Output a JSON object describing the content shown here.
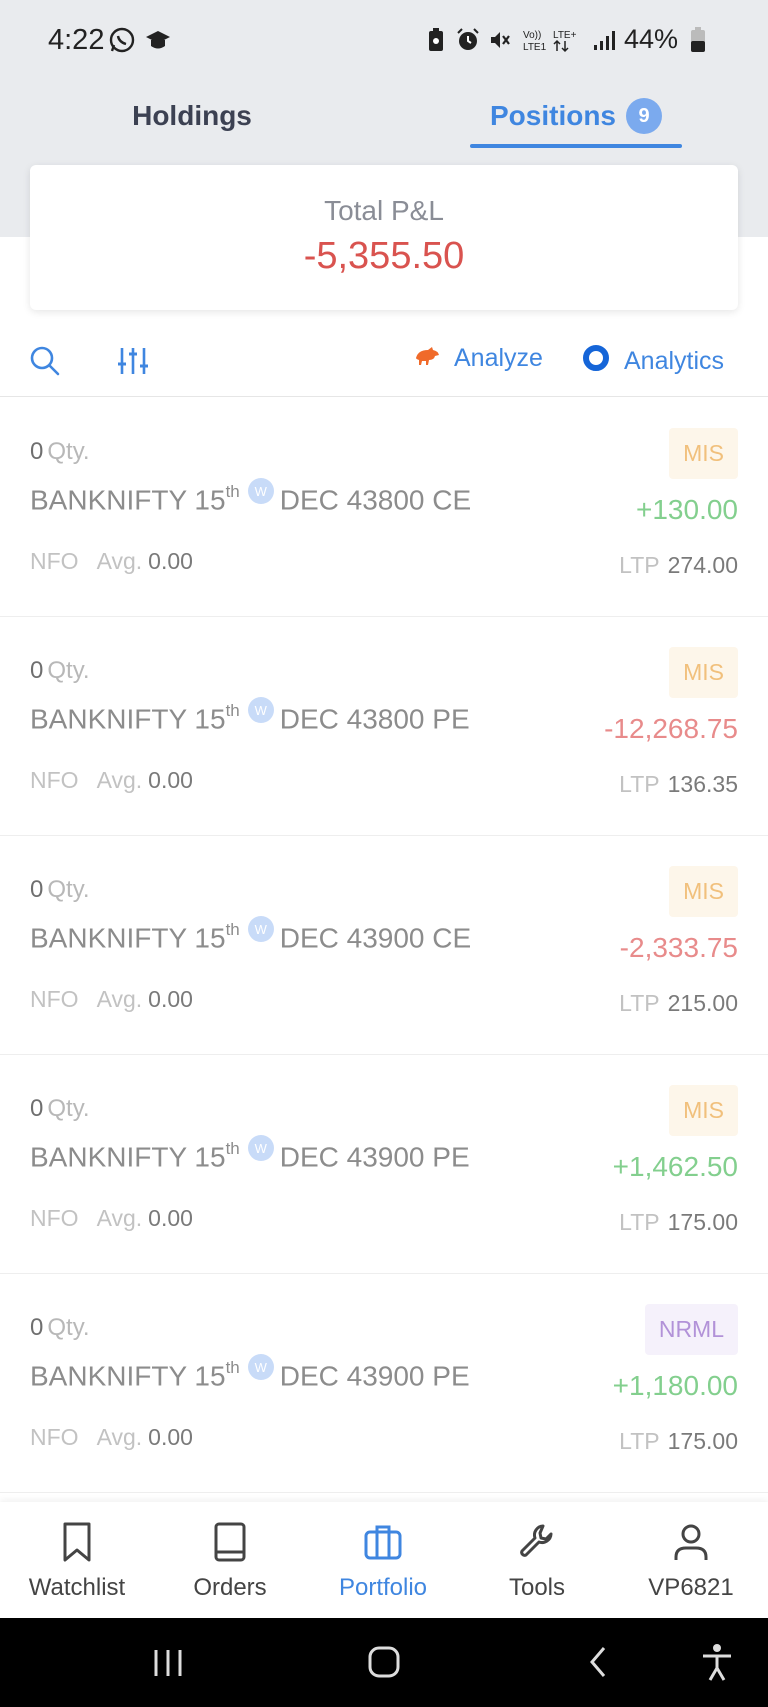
{
  "status_bar": {
    "time": "4:22",
    "left_icons": [
      "whatsapp-icon",
      "graduation-cap-icon"
    ],
    "right_icons": [
      "battery-saver-icon",
      "alarm-icon",
      "mute-icon",
      "volte-lte-icon",
      "signal-icon"
    ],
    "battery": "44%"
  },
  "tabs": {
    "holdings": "Holdings",
    "positions": "Positions",
    "positions_count": "9",
    "active": "positions"
  },
  "summary": {
    "label": "Total P&L",
    "value": "-5,355.50"
  },
  "toolbar": {
    "analyze_label": "Analyze",
    "analytics_label": "Analytics"
  },
  "positions": [
    {
      "qty": "0",
      "qty_label": "Qty.",
      "symbol_main": "BANKNIFTY 15",
      "symbol_sup": "th",
      "weekly_badge": "W",
      "symbol_rest": "DEC 43800 CE",
      "exchange": "NFO",
      "avg_label": "Avg.",
      "avg": "0.00",
      "product": "MIS",
      "pnl": "+130.00",
      "pnl_sign": "pos",
      "ltp_label": "LTP",
      "ltp": "274.00"
    },
    {
      "qty": "0",
      "qty_label": "Qty.",
      "symbol_main": "BANKNIFTY 15",
      "symbol_sup": "th",
      "weekly_badge": "W",
      "symbol_rest": "DEC 43800 PE",
      "exchange": "NFO",
      "avg_label": "Avg.",
      "avg": "0.00",
      "product": "MIS",
      "pnl": "-12,268.75",
      "pnl_sign": "neg",
      "ltp_label": "LTP",
      "ltp": "136.35"
    },
    {
      "qty": "0",
      "qty_label": "Qty.",
      "symbol_main": "BANKNIFTY 15",
      "symbol_sup": "th",
      "weekly_badge": "W",
      "symbol_rest": "DEC 43900 CE",
      "exchange": "NFO",
      "avg_label": "Avg.",
      "avg": "0.00",
      "product": "MIS",
      "pnl": "-2,333.75",
      "pnl_sign": "neg",
      "ltp_label": "LTP",
      "ltp": "215.00"
    },
    {
      "qty": "0",
      "qty_label": "Qty.",
      "symbol_main": "BANKNIFTY 15",
      "symbol_sup": "th",
      "weekly_badge": "W",
      "symbol_rest": "DEC 43900 PE",
      "exchange": "NFO",
      "avg_label": "Avg.",
      "avg": "0.00",
      "product": "MIS",
      "pnl": "+1,462.50",
      "pnl_sign": "pos",
      "ltp_label": "LTP",
      "ltp": "175.00"
    },
    {
      "qty": "0",
      "qty_label": "Qty.",
      "symbol_main": "BANKNIFTY 15",
      "symbol_sup": "th",
      "weekly_badge": "W",
      "symbol_rest": "DEC 43900 PE",
      "exchange": "NFO",
      "avg_label": "Avg.",
      "avg": "0.00",
      "product": "NRML",
      "pnl": "+1,180.00",
      "pnl_sign": "pos",
      "ltp_label": "LTP",
      "ltp": "175.00"
    }
  ],
  "bottom_nav": [
    {
      "label": "Watchlist",
      "icon": "bookmark-icon"
    },
    {
      "label": "Orders",
      "icon": "book-icon"
    },
    {
      "label": "Portfolio",
      "icon": "briefcase-icon",
      "active": true
    },
    {
      "label": "Tools",
      "icon": "wrench-icon"
    },
    {
      "label": "VP6821",
      "icon": "user-icon"
    }
  ],
  "system_nav": [
    "recents-icon",
    "home-icon",
    "back-icon",
    "accessibility-icon"
  ],
  "colors": {
    "accent": "#3f86e0",
    "profit": "#83cf8e",
    "loss": "#e88b8b",
    "total_loss": "#d9534f",
    "mis_badge": "#f1c07c",
    "nrml_badge": "#b292d8"
  }
}
